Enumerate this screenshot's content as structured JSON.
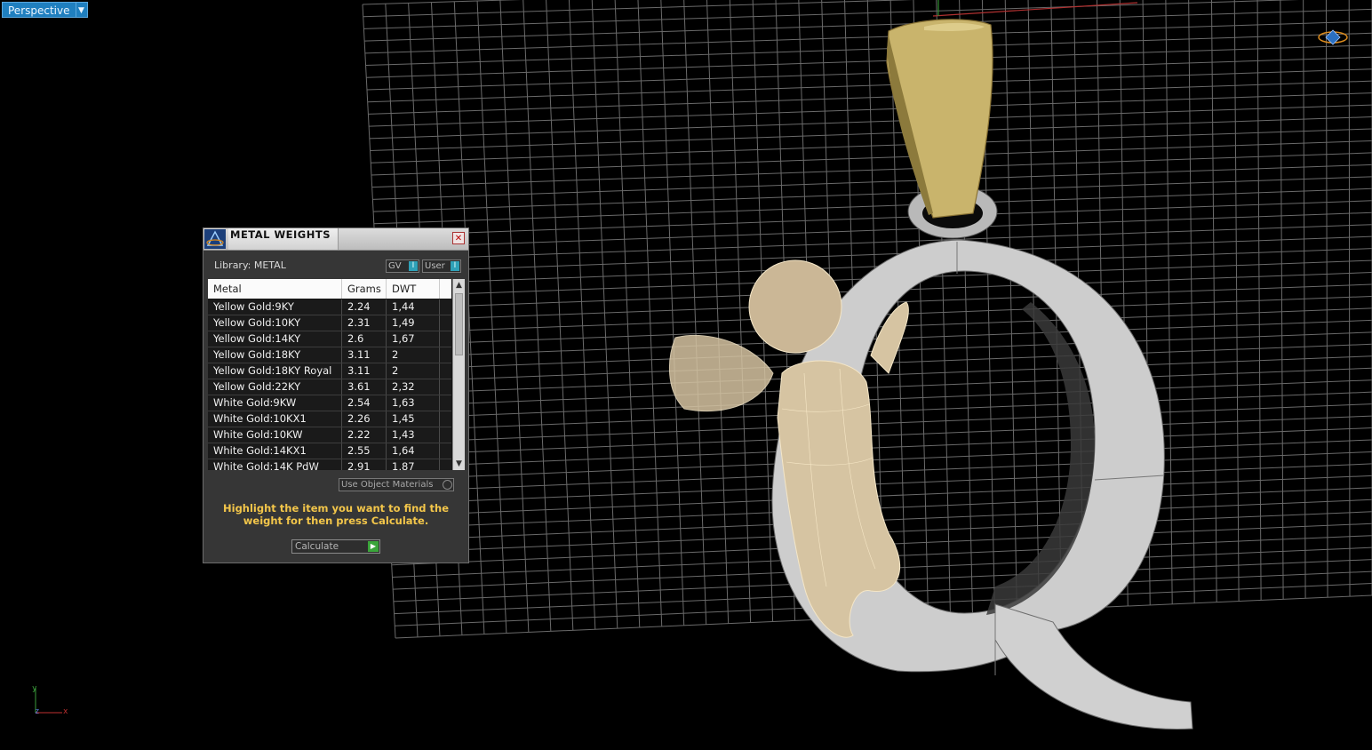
{
  "viewport": {
    "label": "Perspective",
    "dropdown_icon": "triangle-down",
    "axis": {
      "y": "y",
      "z": "z",
      "x": "x"
    }
  },
  "dialog": {
    "title": "METAL WEIGHTS",
    "close_icon": "close-x",
    "library_label": "Library: METAL",
    "gv_label": "GV",
    "user_label": "User",
    "columns": [
      "Metal",
      "Grams",
      "DWT"
    ],
    "rows": [
      [
        "Yellow Gold:9KY",
        "2.24",
        "1,44"
      ],
      [
        "Yellow Gold:10KY",
        "2.31",
        "1,49"
      ],
      [
        "Yellow Gold:14KY",
        "2.6",
        "1,67"
      ],
      [
        "Yellow Gold:18KY",
        "3.11",
        "2"
      ],
      [
        "Yellow Gold:18KY Royal",
        "3.11",
        "2"
      ],
      [
        "Yellow Gold:22KY",
        "3.61",
        "2,32"
      ],
      [
        "White Gold:9KW",
        "2.54",
        "1,63"
      ],
      [
        "White Gold:10KX1",
        "2.26",
        "1,45"
      ],
      [
        "White Gold:10KW",
        "2.22",
        "1,43"
      ],
      [
        "White Gold:14KX1",
        "2.55",
        "1,64"
      ],
      [
        "White Gold:14K PdW",
        "2.91",
        "1,87"
      ]
    ],
    "use_object_materials": "Use Object Materials",
    "hint": "Highlight the item you want to find the weight for then press Calculate.",
    "calculate_label": "Calculate"
  },
  "colors": {
    "viewport_bg": "#000000",
    "grid": "#6a6a6a",
    "label_blue": "#1f7fbf",
    "hint_yellow": "#f3c64a",
    "gold": "#c9b46c",
    "silver": "#cfcfcf",
    "cherub": "#d8c7a8"
  }
}
